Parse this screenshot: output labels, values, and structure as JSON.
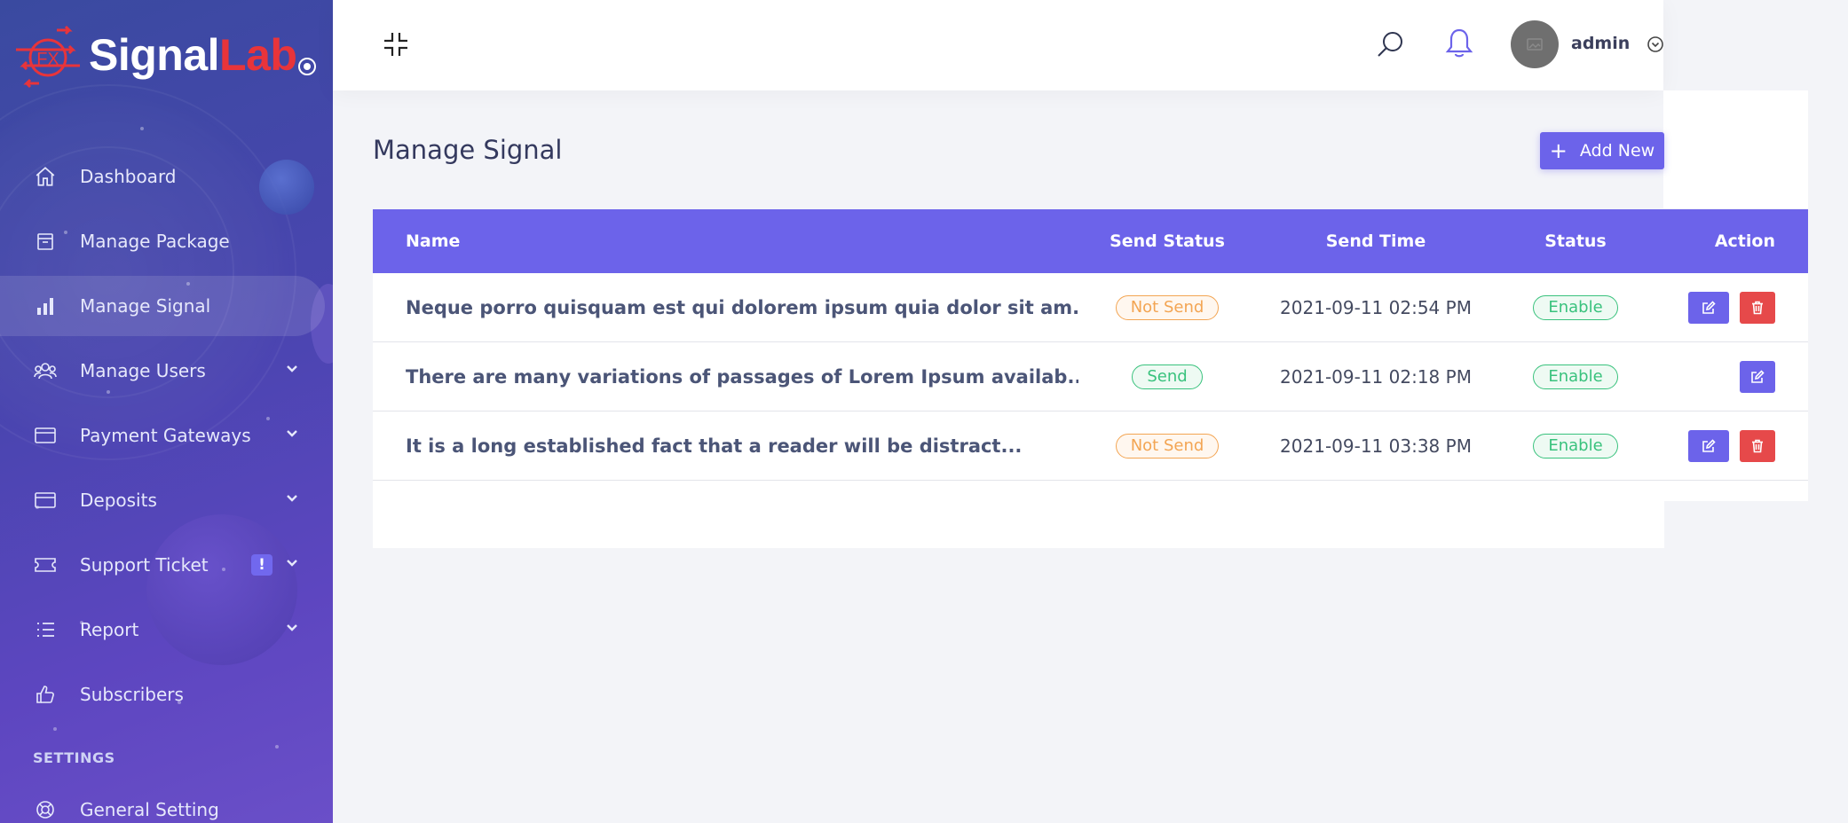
{
  "brand": {
    "signal": "Signal",
    "lab": "Lab",
    "mark_text": "FX"
  },
  "sidebar": {
    "items": [
      {
        "label": "Dashboard"
      },
      {
        "label": "Manage Package"
      },
      {
        "label": "Manage Signal"
      },
      {
        "label": "Manage Users"
      },
      {
        "label": "Payment Gateways"
      },
      {
        "label": "Deposits"
      },
      {
        "label": "Support Ticket",
        "badge": "!"
      },
      {
        "label": "Report"
      },
      {
        "label": "Subscribers"
      }
    ],
    "settings_heading": "SETTINGS",
    "general_setting": "General Setting"
  },
  "header": {
    "user": "admin"
  },
  "page": {
    "title": "Manage Signal",
    "add_new": "Add New"
  },
  "table": {
    "headers": [
      "Name",
      "Send Status",
      "Send Time",
      "Status",
      "Action"
    ],
    "rows": [
      {
        "name": "Neque porro quisquam est qui dolorem ipsum quia dolor sit am...",
        "send_status": "Not Send",
        "send_time": "2021-09-11 02:54 PM",
        "status": "Enable"
      },
      {
        "name": "There are many variations of passages of Lorem Ipsum availab...",
        "send_status": "Send",
        "send_time": "2021-09-11 02:18 PM",
        "status": "Enable"
      },
      {
        "name": "It is a long established fact that a reader will be distract...",
        "send_status": "Not Send",
        "send_time": "2021-09-11 03:38 PM",
        "status": "Enable"
      }
    ]
  },
  "colors": {
    "primary": "#6c63ea",
    "danger": "#e6494a",
    "warning": "#f3a553",
    "success": "#39c27d",
    "brand_red": "#e8343a"
  }
}
